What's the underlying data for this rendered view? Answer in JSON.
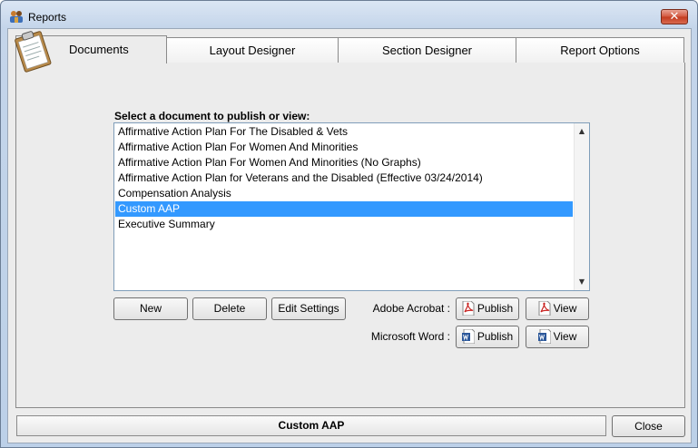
{
  "window": {
    "title": "Reports"
  },
  "tabs": [
    {
      "label": "Documents",
      "active": true
    },
    {
      "label": "Layout Designer",
      "active": false
    },
    {
      "label": "Section Designer",
      "active": false
    },
    {
      "label": "Report Options",
      "active": false
    }
  ],
  "documents": {
    "label": "Select a document to publish or view:",
    "items": [
      "Affirmative Action Plan For The Disabled & Vets",
      "Affirmative Action Plan For Women And Minorities",
      "Affirmative Action Plan For Women And Minorities (No Graphs)",
      "Affirmative Action Plan for Veterans and the Disabled (Effective 03/24/2014)",
      "Compensation Analysis",
      "Custom AAP",
      "Executive Summary"
    ],
    "selected_index": 5
  },
  "actions": {
    "new_label": "New",
    "delete_label": "Delete",
    "edit_settings_label": "Edit Settings"
  },
  "publish": {
    "acrobat_label": "Adobe Acrobat :",
    "word_label": "Microsoft Word :",
    "publish_label": "Publish",
    "view_label": "View"
  },
  "status": {
    "text": "Custom AAP"
  },
  "footer": {
    "close_label": "Close"
  },
  "colors": {
    "selection": "#3399ff",
    "pdf_red": "#c8201e",
    "word_blue": "#2b579a"
  }
}
